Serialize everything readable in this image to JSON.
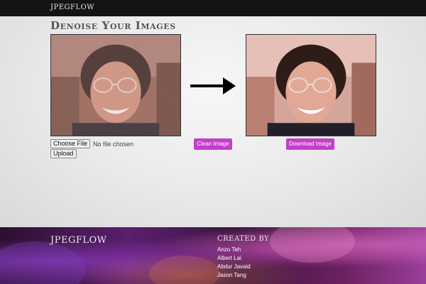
{
  "header": {
    "brand": "JPEGFLOW"
  },
  "main": {
    "title": "Denoise Your Images",
    "file_input": {
      "button_label": "Choose File",
      "status": "No file chosen"
    },
    "upload_label": "Upload",
    "clean_label": "Clean Image",
    "download_label": "Download Image",
    "input_image": {
      "description": "noisy portrait",
      "icon": "photo"
    },
    "output_image": {
      "description": "denoised portrait",
      "icon": "photo"
    },
    "arrow_icon": "right-arrow"
  },
  "footer": {
    "brand": "JPEGFLOW",
    "created_by_heading": "CREATED BY",
    "authors": [
      "Anzo Teh",
      "Albert Lai",
      "Abdur Javaid",
      "Jason Tang"
    ]
  },
  "colors": {
    "topbar": "#141414",
    "accent_button": "#c33ec9",
    "footer_base": "#5a1f6e"
  }
}
